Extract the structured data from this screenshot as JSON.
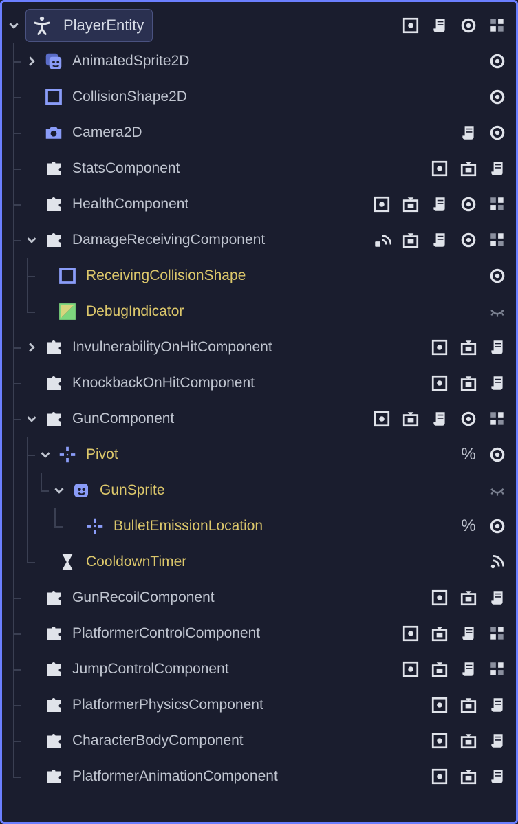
{
  "root": {
    "label": "PlayerEntity",
    "badges": [
      "square-dot",
      "script",
      "visibility",
      "group"
    ]
  },
  "nodes": [
    {
      "depth": 1,
      "last": false,
      "expander": "right",
      "icon": "animsprite",
      "label": "AnimatedSprite2D",
      "unique": false,
      "badges": [
        "visibility"
      ]
    },
    {
      "depth": 1,
      "last": false,
      "expander": "",
      "icon": "collision",
      "label": "CollisionShape2D",
      "unique": false,
      "badges": [
        "visibility"
      ]
    },
    {
      "depth": 1,
      "last": false,
      "expander": "",
      "icon": "camera",
      "label": "Camera2D",
      "unique": false,
      "badges": [
        "script",
        "visibility"
      ]
    },
    {
      "depth": 1,
      "last": false,
      "expander": "",
      "icon": "puzzle",
      "label": "StatsComponent",
      "unique": false,
      "badges": [
        "square-dot",
        "box-arrow",
        "script"
      ]
    },
    {
      "depth": 1,
      "last": false,
      "expander": "",
      "icon": "puzzle",
      "label": "HealthComponent",
      "unique": false,
      "badges": [
        "square-dot",
        "box-arrow",
        "script",
        "visibility",
        "group"
      ]
    },
    {
      "depth": 1,
      "last": false,
      "expander": "down",
      "icon": "puzzle",
      "label": "DamageReceivingComponent",
      "unique": false,
      "badges": [
        "signal",
        "box-arrow",
        "script",
        "visibility",
        "group"
      ]
    },
    {
      "depth": 2,
      "last": false,
      "expander": "",
      "icon": "collision",
      "label": "ReceivingCollisionShape",
      "unique": true,
      "badges": [
        "visibility"
      ]
    },
    {
      "depth": 2,
      "last": true,
      "expander": "",
      "icon": "colorrect",
      "label": "DebugIndicator",
      "unique": true,
      "badges": [
        "hidden"
      ]
    },
    {
      "depth": 1,
      "last": false,
      "expander": "right",
      "icon": "puzzle",
      "label": "InvulnerabilityOnHitComponent",
      "unique": false,
      "badges": [
        "square-dot",
        "box-arrow",
        "script"
      ]
    },
    {
      "depth": 1,
      "last": false,
      "expander": "",
      "icon": "puzzle",
      "label": "KnockbackOnHitComponent",
      "unique": false,
      "badges": [
        "square-dot",
        "box-arrow",
        "script"
      ]
    },
    {
      "depth": 1,
      "last": false,
      "expander": "down",
      "icon": "puzzle",
      "label": "GunComponent",
      "unique": false,
      "badges": [
        "square-dot",
        "box-arrow",
        "script",
        "visibility",
        "group"
      ]
    },
    {
      "depth": 2,
      "last": false,
      "expander": "down",
      "icon": "marker",
      "label": "Pivot",
      "unique": true,
      "badges": [
        "percent",
        "visibility"
      ]
    },
    {
      "depth": 3,
      "last": true,
      "expander": "down",
      "icon": "sprite",
      "label": "GunSprite",
      "unique": true,
      "badges": [
        "hidden"
      ]
    },
    {
      "depth": 4,
      "last": true,
      "expander": "",
      "icon": "marker",
      "label": "BulletEmissionLocation",
      "unique": true,
      "badges": [
        "percent",
        "visibility"
      ]
    },
    {
      "depth": 2,
      "last": true,
      "expander": "",
      "icon": "timer",
      "label": "CooldownTimer",
      "unique": true,
      "badges": [
        "signal-alt"
      ]
    },
    {
      "depth": 1,
      "last": false,
      "expander": "",
      "icon": "puzzle",
      "label": "GunRecoilComponent",
      "unique": false,
      "badges": [
        "square-dot",
        "box-arrow",
        "script"
      ]
    },
    {
      "depth": 1,
      "last": false,
      "expander": "",
      "icon": "puzzle",
      "label": "PlatformerControlComponent",
      "unique": false,
      "badges": [
        "square-dot",
        "box-arrow",
        "script",
        "group"
      ]
    },
    {
      "depth": 1,
      "last": false,
      "expander": "",
      "icon": "puzzle",
      "label": "JumpControlComponent",
      "unique": false,
      "badges": [
        "square-dot",
        "box-arrow",
        "script",
        "group"
      ]
    },
    {
      "depth": 1,
      "last": false,
      "expander": "",
      "icon": "puzzle",
      "label": "PlatformerPhysicsComponent",
      "unique": false,
      "badges": [
        "square-dot",
        "box-arrow",
        "script"
      ]
    },
    {
      "depth": 1,
      "last": false,
      "expander": "",
      "icon": "puzzle",
      "label": "CharacterBodyComponent",
      "unique": false,
      "badges": [
        "square-dot",
        "box-arrow",
        "script"
      ]
    },
    {
      "depth": 1,
      "last": true,
      "expander": "",
      "icon": "puzzle",
      "label": "PlatformerAnimationComponent",
      "unique": false,
      "badges": [
        "square-dot",
        "box-arrow",
        "script"
      ]
    }
  ]
}
